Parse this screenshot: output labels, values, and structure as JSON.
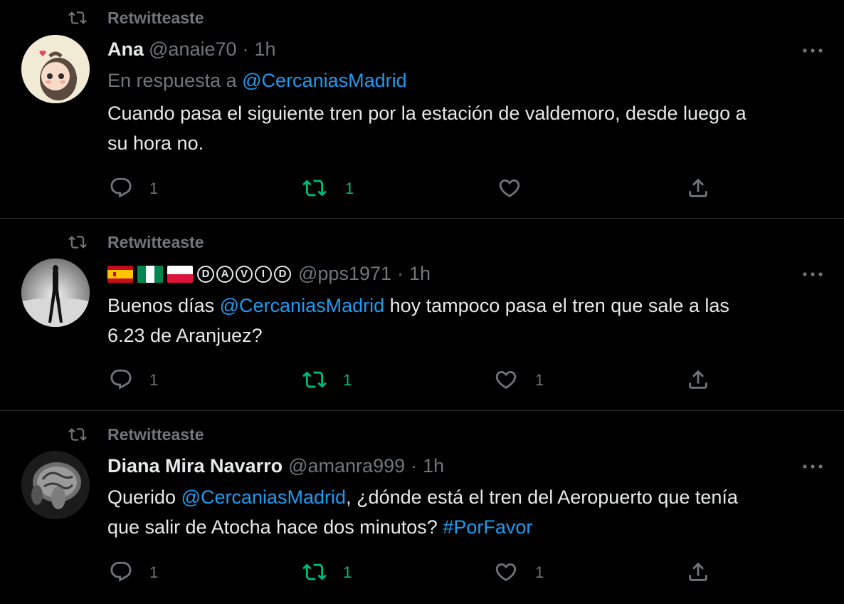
{
  "tweets": [
    {
      "retweet_label": "Retwitteaste",
      "name": "Ana",
      "handle": "@anaie70",
      "separator": "·",
      "time": "1h",
      "reply_prefix": "En respuesta a",
      "reply_to": "@CercaniasMadrid",
      "text_line1": "Cuando pasa el siguiente tren por la estación de valdemoro, desde luego a",
      "text_line2": "su hora no.",
      "replies": "1",
      "retweets": "1",
      "likes": ""
    },
    {
      "retweet_label": "Retwitteaste",
      "name_badges": [
        "D",
        "A",
        "V",
        "I",
        "D"
      ],
      "flags": [
        "spain-flag",
        "nigeria-flag",
        "poland-flag"
      ],
      "handle": "@pps1971",
      "separator": "·",
      "time": "1h",
      "text_a": "Buenos días ",
      "mention": "@CercaniasMadrid",
      "text_b": " hoy tampoco pasa el tren que sale a las",
      "text_line2": "6.23 de Aranjuez?",
      "replies": "1",
      "retweets": "1",
      "likes": "1"
    },
    {
      "retweet_label": "Retwitteaste",
      "name": "Diana Mira Navarro",
      "handle": "@amanra999",
      "separator": "·",
      "time": "1h",
      "text_a": "Querido ",
      "mention": "@CercaniasMadrid",
      "text_b": ", ¿dónde está el tren del Aeropuerto que tenía",
      "text_line2": "que salir de Atocha hace dos minutos? ",
      "hashtag": "#PorFavor",
      "replies": "1",
      "retweets": "1",
      "likes": "1"
    }
  ],
  "colors": {
    "background": "#000000",
    "text": "#e7e9ea",
    "muted": "#71767b",
    "link": "#1d9bf0",
    "retweet_green": "#00ba7c",
    "divider": "#2f3336"
  },
  "icons": [
    "retweet-icon",
    "more-icon",
    "reply-icon",
    "like-icon",
    "share-icon"
  ]
}
